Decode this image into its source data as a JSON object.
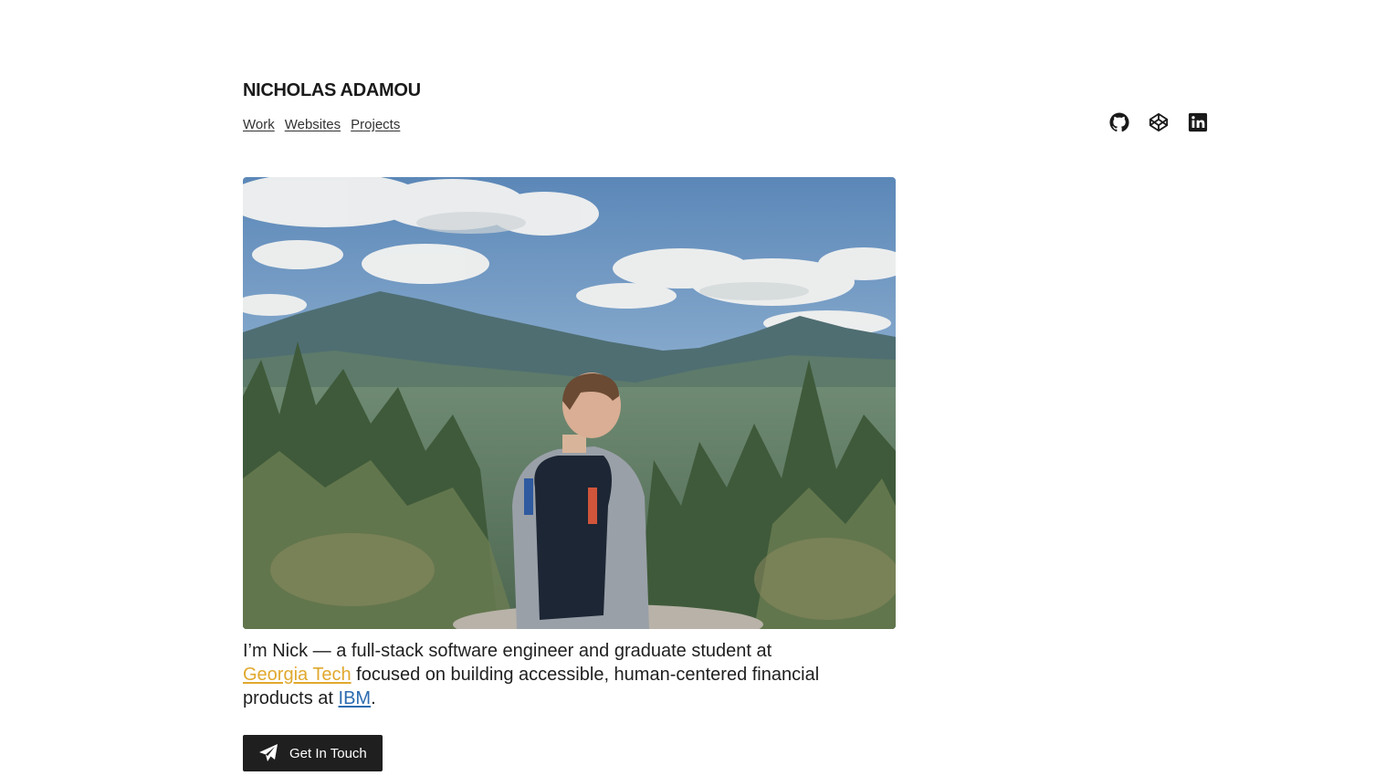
{
  "header": {
    "title": "NICHOLAS ADAMOU",
    "nav": [
      {
        "label": "Work"
      },
      {
        "label": "Websites"
      },
      {
        "label": "Projects"
      }
    ],
    "social": [
      {
        "icon": "github-icon"
      },
      {
        "icon": "codepen-icon"
      },
      {
        "icon": "linkedin-icon"
      }
    ]
  },
  "hero": {
    "image": "mountain-hiker-photo"
  },
  "intro": {
    "text_before": "I’m Nick — a full-stack software engineer and graduate student at ",
    "link1": "Georgia Tech",
    "text_middle": " focused on building accessible, human-centered financial products at ",
    "link2": "IBM",
    "text_after": "."
  },
  "cta": {
    "label": "Get In Touch",
    "icon": "paper-plane-icon"
  },
  "colors": {
    "georgia_tech_link": "#e0a82e",
    "ibm_link": "#2b6cb0",
    "button_bg": "#1f1f1f"
  }
}
